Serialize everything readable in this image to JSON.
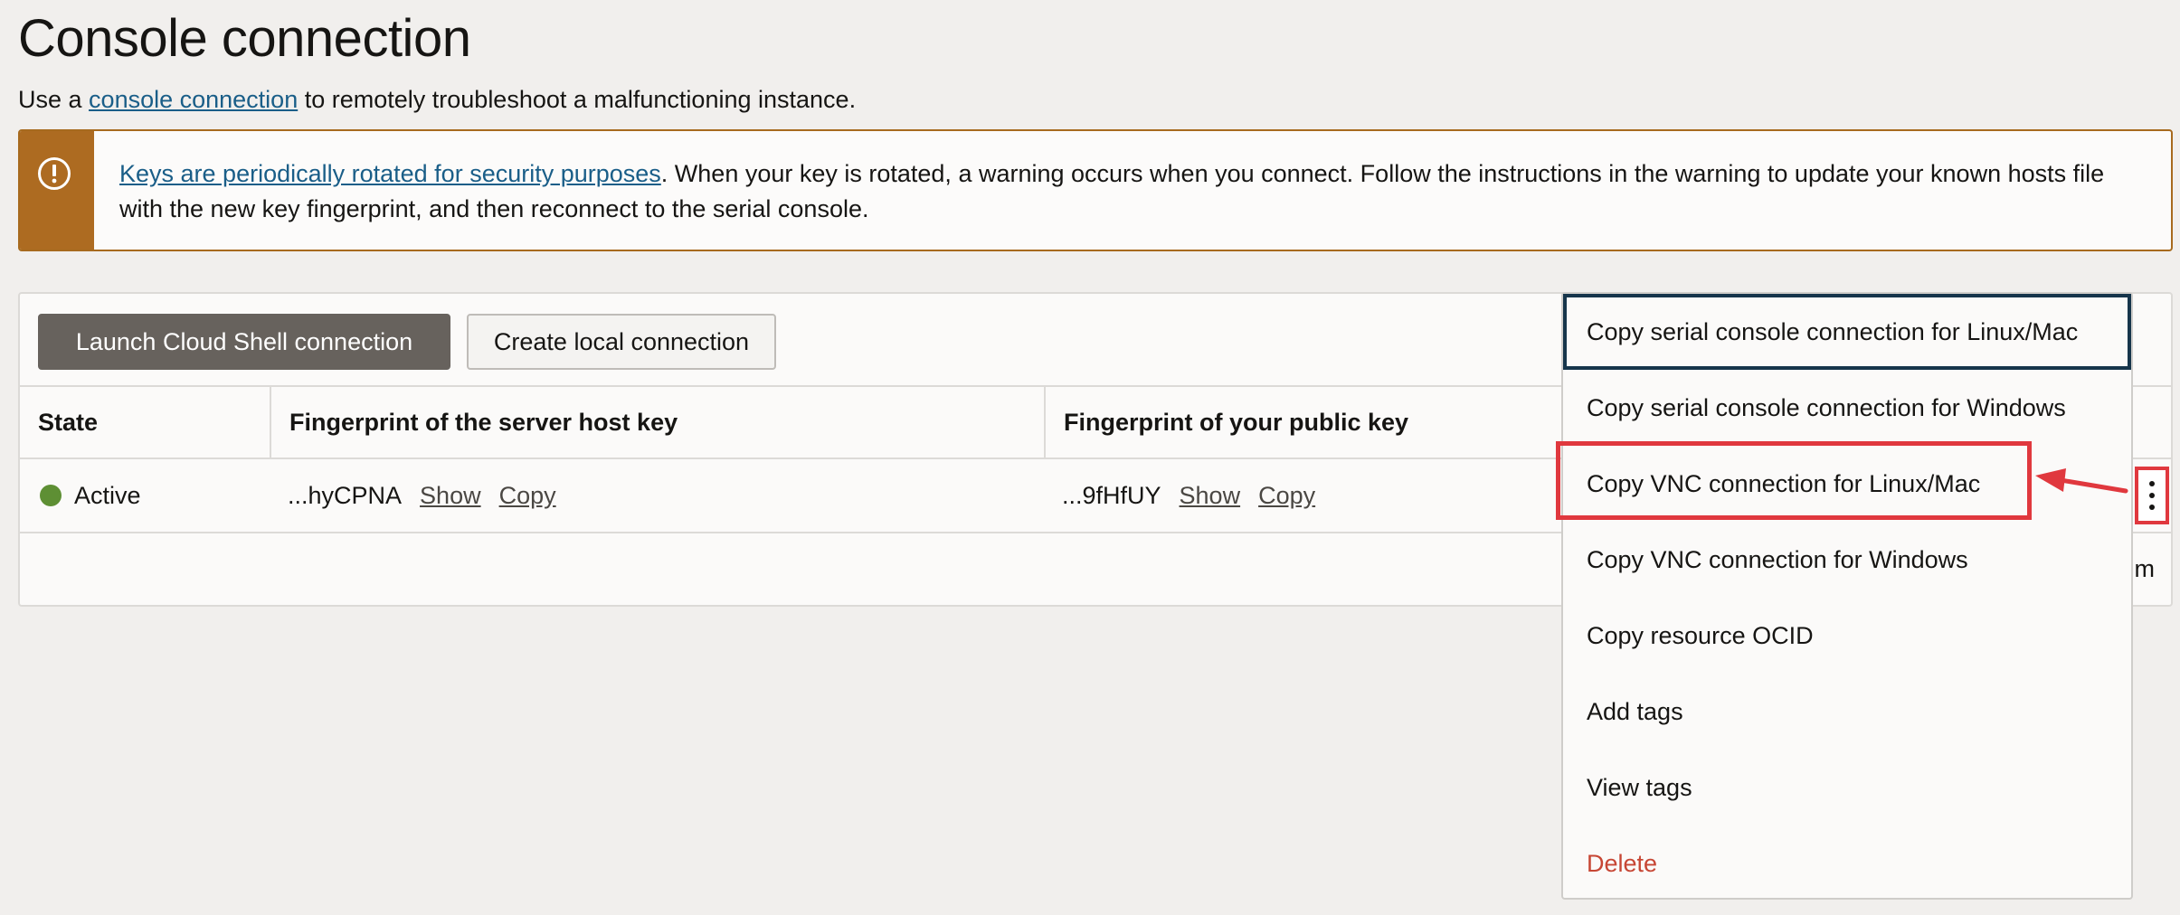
{
  "page": {
    "title": "Console connection",
    "subtitle_prefix": "Use a ",
    "subtitle_link": "console connection",
    "subtitle_suffix": " to remotely troubleshoot a malfunctioning instance."
  },
  "banner": {
    "icon": "warning-icon",
    "link": "Keys are periodically rotated for security purposes",
    "text": ". When your key is rotated, a warning occurs when you connect. Follow the instructions in the warning to update your known hosts file with the new key fingerprint, and then reconnect to the serial console.",
    "accent_color": "#ad6b21"
  },
  "toolbar": {
    "launch_label": "Launch Cloud Shell connection",
    "create_label": "Create local connection"
  },
  "table": {
    "headers": [
      "State",
      "Fingerprint of the server host key",
      "Fingerprint of your public key"
    ],
    "rows": [
      {
        "state": "Active",
        "state_color": "#5e8f34",
        "server_fp": "...hyCPNA",
        "public_fp": "...9fHfUY",
        "show_label": "Show",
        "copy_label": "Copy"
      }
    ],
    "footer_fragment": "m"
  },
  "row_actions": {
    "icon": "kebab-menu-icon",
    "items": [
      {
        "label": "Copy serial console connection for Linux/Mac",
        "focused": true
      },
      {
        "label": "Copy serial console connection for Windows"
      },
      {
        "label": "Copy VNC connection for Linux/Mac",
        "highlighted": true
      },
      {
        "label": "Copy VNC connection for Windows"
      },
      {
        "label": "Copy resource OCID"
      },
      {
        "label": "Add tags"
      },
      {
        "label": "View tags"
      },
      {
        "label": "Delete",
        "danger": true
      }
    ]
  },
  "colors": {
    "link": "#1a5e88",
    "annotation": "#e0383e",
    "danger": "#c74634",
    "primary_button": "#67625d"
  }
}
